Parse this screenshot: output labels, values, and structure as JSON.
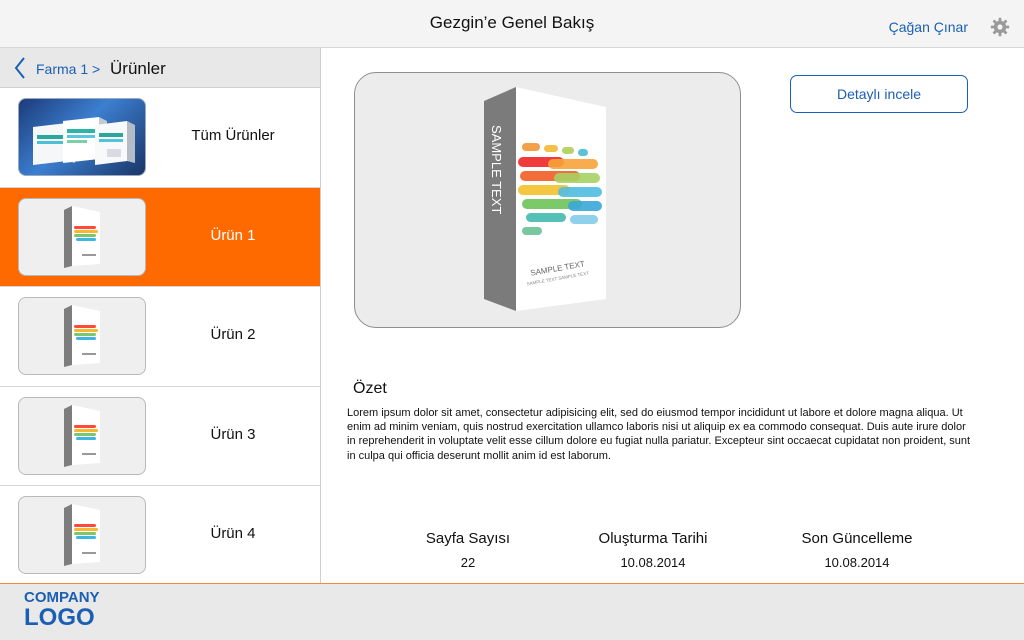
{
  "header": {
    "title": "Gezgin’e Genel Bakış",
    "user_name": "Çağan Çınar"
  },
  "sidebar": {
    "breadcrumb": {
      "parent": "Farma 1 >",
      "current": "Ürünler"
    },
    "items": [
      {
        "label": "Tüm Ürünler"
      },
      {
        "label": "Ürün 1"
      },
      {
        "label": "Ürün 2"
      },
      {
        "label": "Ürün 3"
      },
      {
        "label": "Ürün 4"
      }
    ]
  },
  "main": {
    "box_text_main": "SAMPLE TEXT",
    "box_text_small": "SAMPLE TEXT SAMPLE TEXT",
    "detail_button": "Detaylı incele",
    "summary_title": "Özet",
    "summary_text": "Lorem ipsum dolor sit amet, consectetur adipisicing elit, sed do eiusmod tempor incididunt ut labore et dolore magna aliqua. Ut enim ad minim veniam, quis nostrud exercitation ullamco laboris nisi ut aliquip ex ea commodo consequat. Duis aute irure dolor in reprehenderit in voluptate velit esse cillum dolore eu fugiat nulla pariatur. Excepteur sint occaecat cupidatat non proident, sunt in culpa qui officia deserunt mollit anim id est laborum.",
    "stats": [
      {
        "label": "Sayfa Sayısı",
        "value": "22"
      },
      {
        "label": "Oluşturma Tarihi",
        "value": "10.08.2014"
      },
      {
        "label": "Son Güncelleme",
        "value": "10.08.2014"
      }
    ]
  },
  "footer": {
    "logo_line1": "COMPANY",
    "logo_line2": "LOGO"
  },
  "colors": {
    "accent": "#ff6a00",
    "link": "#1b5fb4"
  }
}
